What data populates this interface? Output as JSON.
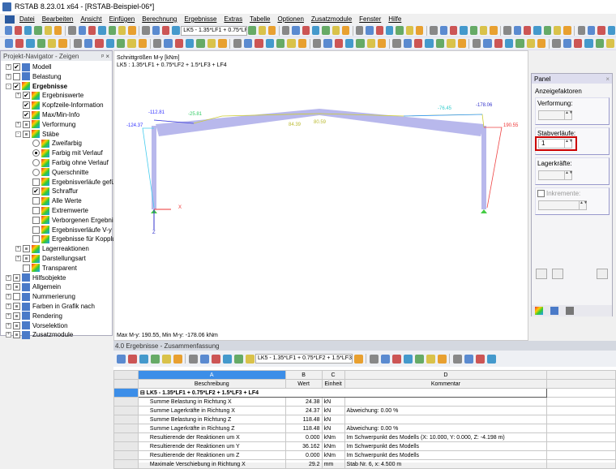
{
  "window": {
    "title": "RSTAB 8.23.01 x64 - [RSTAB-Beispiel-06*]"
  },
  "menu": [
    "Datei",
    "Bearbeiten",
    "Ansicht",
    "Einfügen",
    "Berechnung",
    "Ergebnisse",
    "Extras",
    "Tabelle",
    "Optionen",
    "Zusatzmodule",
    "Fenster",
    "Hilfe"
  ],
  "toolbar": {
    "loadcase_combo": "LK5 - 1.35*LF1 + 0.75*LF2 -"
  },
  "navigator": {
    "title": "Projekt-Navigator - Zeigen",
    "pin": "ᵖ",
    "close": "×",
    "items": [
      {
        "label": "Modell",
        "level": 0,
        "exp": "+",
        "check": "checked",
        "icon": "model"
      },
      {
        "label": "Belastung",
        "level": 0,
        "exp": "+",
        "check": "empty",
        "icon": "load"
      },
      {
        "label": "Ergebnisse",
        "level": 0,
        "exp": "-",
        "check": "checked",
        "icon": "results",
        "bold": true
      },
      {
        "label": "Ergebniswerte",
        "level": 1,
        "exp": "+",
        "check": "checked",
        "icon": "results"
      },
      {
        "label": "Kopfzeile-Information",
        "level": 1,
        "check": "checked",
        "icon": "results"
      },
      {
        "label": "Max/Min-Info",
        "level": 1,
        "check": "checked",
        "icon": "results"
      },
      {
        "label": "Verformung",
        "level": 1,
        "exp": "+",
        "check": "partial",
        "icon": "results"
      },
      {
        "label": "Stäbe",
        "level": 1,
        "exp": "-",
        "check": "partial",
        "icon": "results"
      },
      {
        "label": "Zweifarbig",
        "level": 2,
        "radio": "off",
        "icon": "results"
      },
      {
        "label": "Farbig mit Verlauf",
        "level": 2,
        "radio": "on",
        "icon": "results"
      },
      {
        "label": "Farbig ohne Verlauf",
        "level": 2,
        "radio": "off",
        "icon": "results"
      },
      {
        "label": "Querschnitte",
        "level": 2,
        "radio": "off",
        "icon": "results"
      },
      {
        "label": "Ergebnisverläufe gefü",
        "level": 2,
        "check": "empty",
        "icon": "results"
      },
      {
        "label": "Schraffur",
        "level": 2,
        "check": "checked",
        "icon": "results"
      },
      {
        "label": "Alle Werte",
        "level": 2,
        "check": "empty",
        "icon": "results"
      },
      {
        "label": "Extremwerte",
        "level": 2,
        "check": "empty",
        "icon": "results"
      },
      {
        "label": "Verborgenen Ergebni",
        "level": 2,
        "check": "empty",
        "icon": "results"
      },
      {
        "label": "Ergebnisverläufe V-y",
        "level": 2,
        "check": "empty",
        "icon": "results"
      },
      {
        "label": "Ergebnisse für Kopplu",
        "level": 2,
        "check": "empty",
        "icon": "results"
      },
      {
        "label": "Lagerreaktionen",
        "level": 1,
        "exp": "+",
        "check": "partial",
        "icon": "results"
      },
      {
        "label": "Darstellungsart",
        "level": 1,
        "exp": "+",
        "check": "partial",
        "icon": "results"
      },
      {
        "label": "Transparent",
        "level": 1,
        "check": "empty",
        "icon": "results"
      },
      {
        "label": "Hilfsobjekte",
        "level": 0,
        "exp": "+",
        "check": "partial",
        "icon": "guide"
      },
      {
        "label": "Allgemein",
        "level": 0,
        "exp": "+",
        "check": "partial",
        "icon": "general"
      },
      {
        "label": "Nummerierung",
        "level": 0,
        "exp": "+",
        "check": "empty",
        "icon": "numbering"
      },
      {
        "label": "Farben in Grafik nach",
        "level": 0,
        "exp": "+",
        "check": "partial",
        "icon": "model"
      },
      {
        "label": "Rendering",
        "level": 0,
        "exp": "+",
        "check": "partial",
        "icon": "render"
      },
      {
        "label": "Vorselektion",
        "level": 0,
        "exp": "+",
        "check": "partial",
        "icon": "model"
      },
      {
        "label": "Zusatzmodule",
        "level": 0,
        "exp": "+",
        "check": "partial",
        "icon": "addon"
      }
    ]
  },
  "graphic": {
    "header1": "Schnittgrößen M-y [kNm]",
    "header2": "LK5 : 1.35*LF1 + 0.75*LF2 + 1.5*LF3 + LF4",
    "labels": {
      "l1": "-124.37",
      "l2": "-112.81",
      "l3": "-25.81",
      "l4": "84.39",
      "l5": "80.59",
      "l6": "-76.45",
      "l7": "-178.06",
      "l8": "190.55"
    },
    "axis_x": "X",
    "axis_z": "Z",
    "maxmin": "Max M-y: 190.55, Min M-y: -178.06 kNm"
  },
  "panel": {
    "title": "Panel",
    "close": "×",
    "section": "Anzeigefaktoren",
    "verformung": "Verformung:",
    "stabverlaeufe": "Stabverläufe:",
    "stab_value": "1",
    "lagerkraefte": "Lagerkräfte:",
    "inkremente": "Inkremente:"
  },
  "results": {
    "title": "4.0 Ergebnisse - Zusammenfassung",
    "combo": "LK5 - 1.35*LF1 + 0.75*LF2 + 1.5*LF3",
    "col_letters": [
      "A",
      "B",
      "C",
      "D"
    ],
    "col_headers": [
      "Beschreibung",
      "Wert",
      "Einheit",
      "Kommentar"
    ],
    "group": "⊟ LK5 - 1.35*LF1 + 0.75*LF2 + 1.5*LF3 + LF4",
    "rows": [
      [
        "Summe Belastung in Richtung X",
        "24.38",
        "kN",
        ""
      ],
      [
        "Summe Lagerkräfte in Richtung X",
        "24.37",
        "kN",
        "Abweichung:  0.00 %"
      ],
      [
        "Summe Belastung in Richtung Z",
        "118.48",
        "kN",
        ""
      ],
      [
        "Summe Lagerkräfte in Richtung Z",
        "118.48",
        "kN",
        "Abweichung:  0.00 %"
      ],
      [
        "Resultierende der Reaktionen um X",
        "0.000",
        "kNm",
        "Im Schwerpunkt des Modells (X: 10.000, Y: 0.000, Z: -4.198 m)"
      ],
      [
        "Resultierende der Reaktionen um Y",
        "36.162",
        "kNm",
        "Im Schwerpunkt des Modells"
      ],
      [
        "Resultierende der Reaktionen um Z",
        "0.000",
        "kNm",
        "Im Schwerpunkt des Modells"
      ],
      [
        "Maximale Verschiebung in Richtung X",
        "29.2",
        "mm",
        "Stab Nr. 6,  x: 4.500 m"
      ]
    ]
  }
}
